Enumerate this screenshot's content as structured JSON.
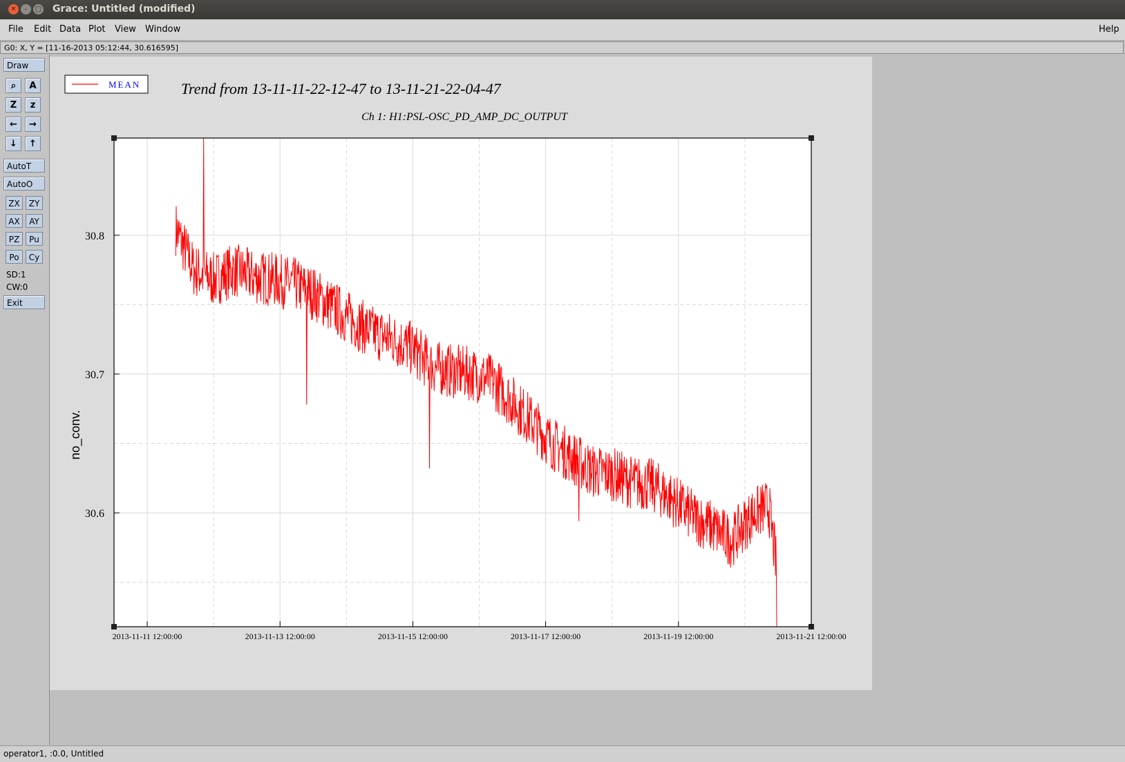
{
  "window": {
    "title": "Grace: Untitled (modified)"
  },
  "menubar": {
    "file": "File",
    "edit": "Edit",
    "data": "Data",
    "plot": "Plot",
    "view": "View",
    "window": "Window",
    "help": "Help"
  },
  "locator": {
    "text": "G0: X, Y = [11-16-2013 05:12:44, 30.616595]"
  },
  "toolbar": {
    "draw": "Draw",
    "autot": "AutoT",
    "autoo": "AutoO",
    "zx": "ZX",
    "zy": "ZY",
    "ax": "AX",
    "ay": "AY",
    "pz": "PZ",
    "pu": "Pu",
    "po": "Po",
    "cy": "Cy",
    "sd": "SD:1",
    "cw": "CW:0",
    "exit": "Exit"
  },
  "legend": {
    "label": "MEAN"
  },
  "statusbar": {
    "text": "operator1, :0.0, Untitled"
  },
  "colors": {
    "series": "#ff0000",
    "legend_text": "#0000ff"
  },
  "chart_data": {
    "type": "line",
    "title": "Trend from 13-11-11-22-12-47 to 13-11-21-22-04-47",
    "subtitle": "Ch 1: H1:PSL-OSC_PD_AMP_DC_OUTPUT",
    "xlabel": "",
    "ylabel": "no_conv.",
    "x_ticks": [
      "2013-11-11 12:00:00",
      "2013-11-13 12:00:00",
      "2013-11-15 12:00:00",
      "2013-11-17 12:00:00",
      "2013-11-19 12:00:00",
      "2013-11-21 12:00:00"
    ],
    "y_ticks": [
      "30.6",
      "30.7",
      "30.8"
    ],
    "y_range": [
      30.518,
      30.87
    ],
    "x_range_days": [
      0,
      10.5
    ],
    "grid": true,
    "legend_position": "top-left",
    "series": [
      {
        "name": "MEAN",
        "color": "#ff0000",
        "x_days_from_2013-11-11T00:00": [
          0.93,
          1.2,
          1.5,
          1.8,
          2.1,
          2.4,
          2.7,
          3.0,
          3.3,
          3.6,
          3.9,
          4.2,
          4.5,
          4.8,
          5.1,
          5.4,
          5.7,
          6.0,
          6.3,
          6.6,
          6.9,
          7.2,
          7.5,
          7.8,
          8.1,
          8.4,
          8.7,
          9.0,
          9.3,
          9.6,
          9.86,
          9.98
        ],
        "values": [
          30.805,
          30.775,
          30.768,
          30.775,
          30.77,
          30.768,
          30.765,
          30.758,
          30.748,
          30.738,
          30.73,
          30.725,
          30.718,
          30.705,
          30.702,
          30.7,
          30.695,
          30.68,
          30.665,
          30.65,
          30.64,
          30.63,
          30.628,
          30.622,
          30.62,
          30.61,
          30.598,
          30.59,
          30.58,
          30.598,
          30.605,
          30.56
        ],
        "band": 0.018,
        "spikes": [
          {
            "x": 1.35,
            "value": 30.87
          },
          {
            "x": 3.0,
            "value": 30.775
          },
          {
            "x": 2.9,
            "value": 30.678
          },
          {
            "x": 4.75,
            "value": 30.632
          },
          {
            "x": 7.0,
            "value": 30.594
          },
          {
            "x": 9.98,
            "value": 30.518
          }
        ]
      }
    ]
  }
}
